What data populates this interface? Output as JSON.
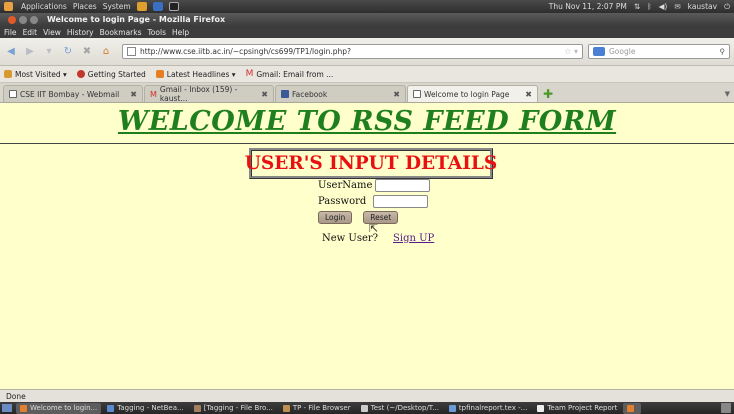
{
  "top_panel": {
    "menus": [
      "Applications",
      "Places",
      "System"
    ],
    "datetime": "Thu Nov 11,  2:07 PM",
    "user": "kaustav"
  },
  "window": {
    "title": "Welcome to login Page - Mozilla Firefox"
  },
  "menubar": [
    "File",
    "Edit",
    "View",
    "History",
    "Bookmarks",
    "Tools",
    "Help"
  ],
  "navbar": {
    "url": "http://www.cse.iitb.ac.in/~cpsingh/cs699/TP1/login.php?",
    "search_placeholder": "Google"
  },
  "bookmarks": [
    "Most Visited ▾",
    "Getting Started",
    "Latest Headlines ▾",
    "Gmail: Email from ..."
  ],
  "tabs": [
    {
      "label": "CSE IIT Bombay - Webmail"
    },
    {
      "label": "Gmail - Inbox (159) - kaust..."
    },
    {
      "label": "Facebook"
    },
    {
      "label": "Welcome to login Page"
    }
  ],
  "page": {
    "heading": "WELCOME TO RSS FEED FORM",
    "box_title": "USER'S INPUT DETAILS",
    "username_label": "UserName",
    "password_label": "Password",
    "login_button": "Login",
    "reset_button": "Reset",
    "new_user_label": "New User?",
    "signup_link": "Sign UP"
  },
  "statusbar": {
    "text": "Done"
  },
  "taskbar": [
    {
      "label": "Welcome to login..."
    },
    {
      "label": "Tagging - NetBea..."
    },
    {
      "label": "[Tagging - File Bro..."
    },
    {
      "label": "TP - File Browser"
    },
    {
      "label": "Test (~/Desktop/T..."
    },
    {
      "label": "tpfinalreport.tex -..."
    },
    {
      "label": "Team Project Report"
    }
  ],
  "colors": {
    "page_bg": "#ffffcc",
    "heading": "#1f7f1f",
    "box_title": "#e81010",
    "link": "#551a8b"
  }
}
